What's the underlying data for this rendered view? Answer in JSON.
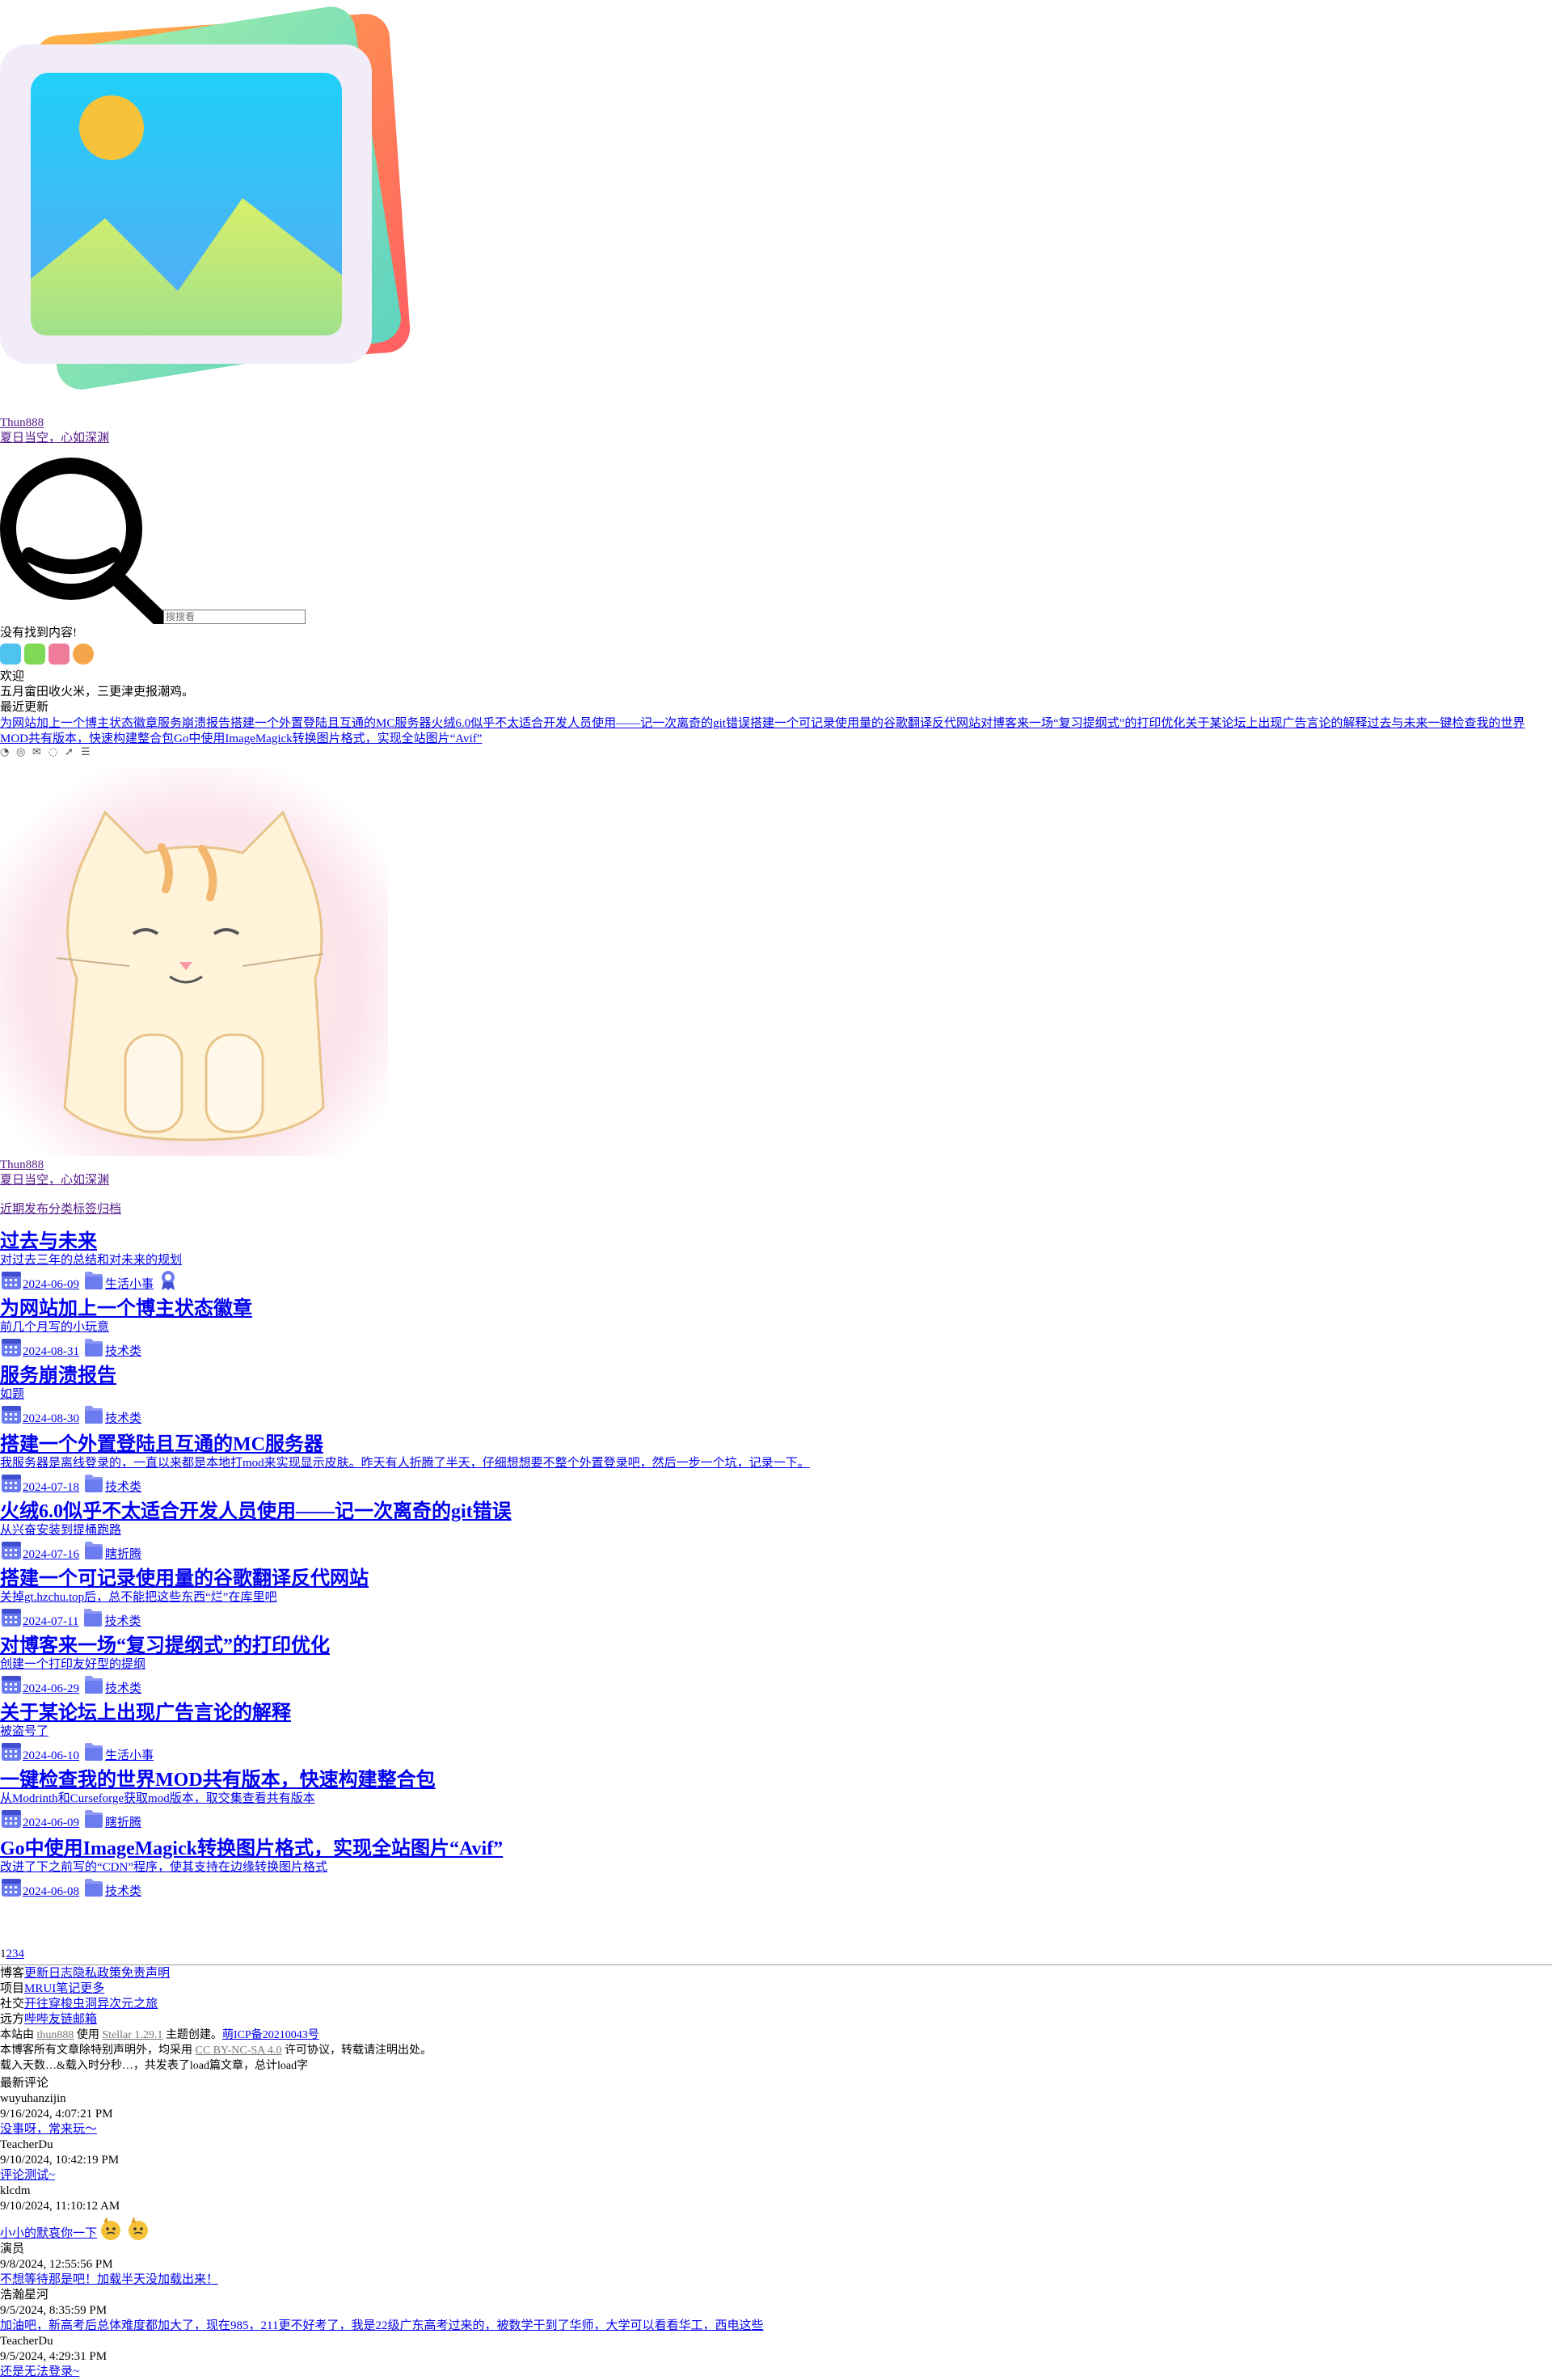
{
  "brand": {
    "name": "Thun888",
    "tagline": "夏日当空，心如深渊"
  },
  "search": {
    "placeholder": "搜搜看",
    "empty_text": "没有找到内容!"
  },
  "welcome": {
    "title": "欢迎",
    "message": "五月畲田收火米，三更津吏报潮鸡。",
    "recent_label": "最近更新",
    "recent_items": [
      "为网站加上一个博主状态徽章",
      "服务崩溃报告",
      "搭建一个外置登陆且互通的MC服务器",
      "火绒6.0似乎不太适合开发人员使用——记一次离奇的git错误",
      "搭建一个可记录使用量的谷歌翻译反代网站",
      "对博客来一场“复习提纲式”的打印优化",
      "关于某论坛上出现广告言论的解释",
      "过去与未来",
      "一键检查我的世界MOD共有版本，快速构建整合包",
      "Go中使用ImageMagick转换图片格式，实现全站图片“Avif”"
    ]
  },
  "social_icons": [
    "rss-icon",
    "github-icon",
    "mail-icon",
    "qq-icon",
    "telegram-icon",
    "list-icon"
  ],
  "tabs": [
    "近期发布",
    "分类",
    "标签",
    "归档"
  ],
  "posts": [
    {
      "title": "过去与未来",
      "desc": "对过去三年的总结和对未来的规划",
      "date": "2024-06-09",
      "category": "生活小事"
    },
    {
      "title": "为网站加上一个博主状态徽章",
      "desc": "前几个月写的小玩意",
      "date": "2024-08-31",
      "category": "技术类"
    },
    {
      "title": "服务崩溃报告",
      "desc": "如题",
      "date": "2024-08-30",
      "category": "技术类"
    },
    {
      "title": "搭建一个外置登陆且互通的MC服务器",
      "desc": "我服务器是离线登录的，一直以来都是本地打mod来实现显示皮肤。昨天有人折腾了半天，仔细想想要不整个外置登录吧，然后一步一个坑，记录一下。",
      "date": "2024-07-18",
      "category": "技术类"
    },
    {
      "title": "火绒6.0似乎不太适合开发人员使用——记一次离奇的git错误",
      "desc": "从兴奋安装到提桶跑路",
      "date": "2024-07-16",
      "category": "瞎折腾"
    },
    {
      "title": "搭建一个可记录使用量的谷歌翻译反代网站",
      "desc": "关掉gt.hzchu.top后，总不能把这些东西“烂”在库里吧",
      "date": "2024-07-11",
      "category": "技术类"
    },
    {
      "title": "对博客来一场“复习提纲式”的打印优化",
      "desc": "创建一个打印友好型的提纲",
      "date": "2024-06-29",
      "category": "技术类"
    },
    {
      "title": "关于某论坛上出现广告言论的解释",
      "desc": "被盗号了",
      "date": "2024-06-10",
      "category": "生活小事"
    },
    {
      "title": "一键检查我的世界MOD共有版本，快速构建整合包",
      "desc": "从Modrinth和Curseforge获取mod版本，取交集查看共有版本",
      "date": "2024-06-09",
      "category": "瞎折腾"
    },
    {
      "title": "Go中使用ImageMagick转换图片格式，实现全站图片“Avif”",
      "desc": "改进了下之前写的“CDN”程序，使其支持在边缘转换图片格式",
      "date": "2024-06-08",
      "category": "技术类"
    }
  ],
  "pager": [
    "1",
    "2",
    "3",
    "4"
  ],
  "footer": {
    "rows": [
      {
        "label": "博客",
        "links": [
          "更新日志",
          "隐私政策",
          "免责声明"
        ]
      },
      {
        "label": "项目",
        "links": [
          "MRUI",
          "笔记",
          "更多"
        ]
      },
      {
        "label": "社交",
        "links": [
          "开往",
          "穿梭",
          "虫洞",
          "异次元之旅"
        ]
      },
      {
        "label": "远方",
        "links": [
          "哔哔",
          "友链",
          "邮箱"
        ]
      }
    ],
    "powered": {
      "prefix": "本站由",
      "author": "thun888",
      "use": "使用",
      "theme": "Stellar 1.29.1",
      "created": "主题创建。",
      "icp": "萌ICP备20210043号"
    },
    "license": {
      "prefix": "本博客所有文章除特别声明外，均采用",
      "link": "CC BY-NC-SA 4.0",
      "suffix": "许可协议，转载请注明出处。"
    },
    "stats": "载入天数…&载入时分秒…，共发表了load篇文章，总计load字"
  },
  "comments": {
    "title": "最新评论",
    "items": [
      {
        "name": "wuyuhanzijin",
        "time": "9/16/2024, 4:07:21 PM",
        "text": "没事呀，常来玩～"
      },
      {
        "name": "TeacherDu",
        "time": "9/10/2024, 10:42:19 PM",
        "text": "评论测试~"
      },
      {
        "name": "klcdm",
        "time": "9/10/2024, 11:10:12 AM",
        "text": "小小的默哀你一下"
      },
      {
        "name": "演员",
        "time": "9/8/2024, 12:55:56 PM",
        "text": "不想等待那是吧！加载半天没加载出来！"
      },
      {
        "name": "浩瀚星河",
        "time": "9/5/2024, 8:35:59 PM",
        "text": "加油吧，新高考后总体难度都加大了，现在985，211更不好考了，我是22级广东高考过来的，被数学干到了华师，大学可以看看华工，西电这些"
      },
      {
        "name": "TeacherDu",
        "time": "9/5/2024, 4:29:31 PM",
        "text": "还是无法登录~"
      }
    ]
  },
  "colors": {
    "link": "#0000ee",
    "visited": "#551a8b",
    "icon_accent": "#6b7cf0"
  }
}
